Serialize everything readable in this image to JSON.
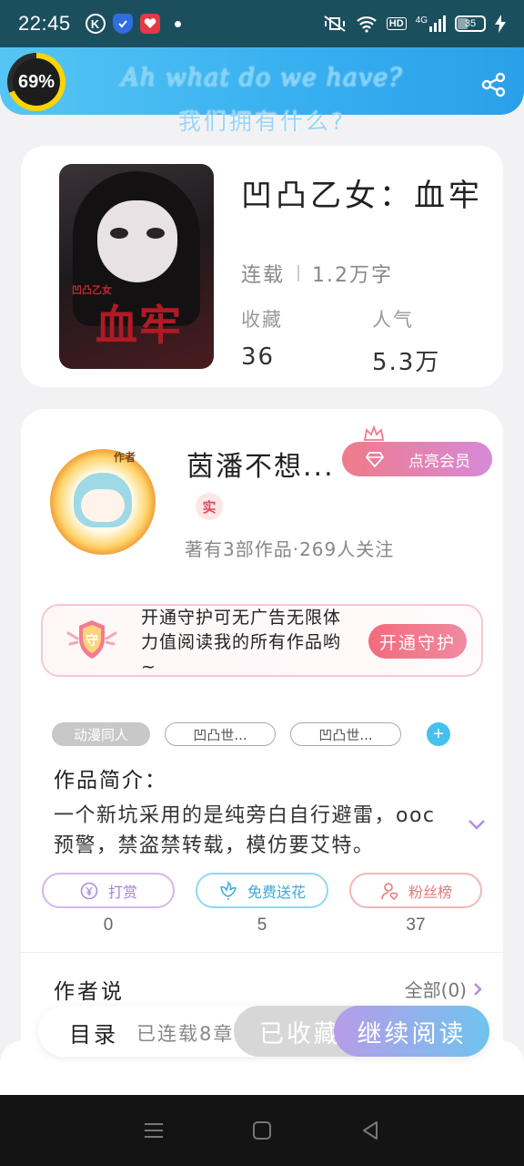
{
  "status_bar": {
    "time": "22:45",
    "left_icons": [
      "k-icon",
      "shield-icon",
      "heart-icon",
      "dot"
    ],
    "hd": "HD",
    "signal": "4G",
    "battery": "35"
  },
  "header": {
    "progress_label": "69%",
    "progress_value": 69,
    "title_en": "Ah what do we have?",
    "title_zh": "我们拥有什么?",
    "accent": "#36aef0"
  },
  "book": {
    "title": "凹凸乙女：血牢",
    "status": "连载",
    "word_count": "1.2万字",
    "stats": [
      {
        "label": "收藏",
        "value": "36"
      },
      {
        "label": "人气",
        "value": "5.3万"
      }
    ],
    "cover_text": "血牢",
    "cover_small_text": "凹凸乙女"
  },
  "author": {
    "avatar_tag": "作者",
    "name": "茵潘不想...",
    "vip_button": "点亮会员",
    "real_badge": "实",
    "stats_text": "著有3部作品·269人关注",
    "guard": {
      "text": "开通守护可无广告无限体力值阅读我的所有作品哟~",
      "button": "开通守护",
      "shield_char": "守"
    },
    "tags": [
      "动漫同人",
      "凹凸世...",
      "凹凸世..."
    ],
    "tag_add": "+",
    "intro_title": "作品简介：",
    "intro_text": "一个新坑采用的是纯旁白自行避雷，ooc预警，禁盗禁转载，模仿要艾特。",
    "actions": [
      {
        "label": "打赏",
        "icon": "yen-coin-icon",
        "count": "0"
      },
      {
        "label": "免费送花",
        "icon": "flower-icon",
        "count": "5"
      },
      {
        "label": "粉丝榜",
        "icon": "fan-user-icon",
        "count": "37"
      }
    ],
    "author_says": "作者说",
    "all_link": "全部(0)"
  },
  "bottom_bar": {
    "toc": "目录",
    "serial_info": "已连载8章",
    "collected": "已收藏",
    "continue_read": "继续阅读"
  },
  "nav": [
    "menu-icon",
    "home-square-icon",
    "back-triangle-icon"
  ]
}
